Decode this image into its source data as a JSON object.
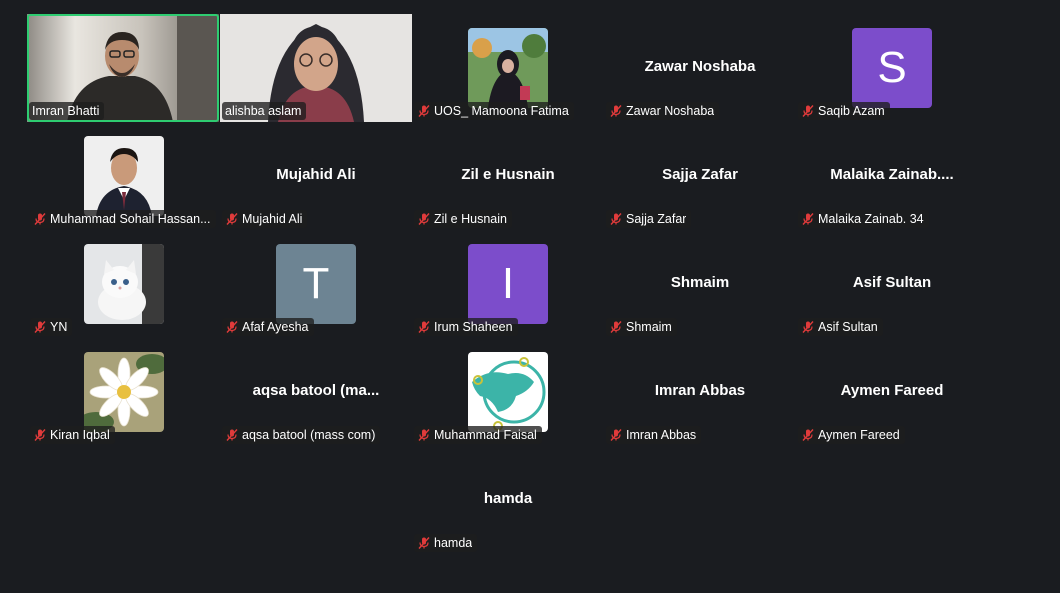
{
  "colors": {
    "background": "#1a1c20",
    "speaking_border": "#2ecc71",
    "avatar_purple": "#7c4dcb",
    "avatar_slate": "#6d8493",
    "muted_mic": "#e03b3b"
  },
  "participants": {
    "imran_bhatti": {
      "label": "Imran Bhatti"
    },
    "alishba_aslam": {
      "label": "alishba aslam"
    },
    "mamoona_fatima": {
      "label": "UOS_ Mamoona Fatima"
    },
    "zawar_noshaba": {
      "display": "Zawar Noshaba",
      "label": "Zawar Noshaba"
    },
    "saqib_azam": {
      "avatar_letter": "S",
      "label": "Saqib Azam"
    },
    "sohail_hassan": {
      "label": "Muhammad Sohail Hassan..."
    },
    "mujahid_ali": {
      "display": "Mujahid Ali",
      "label": "Mujahid Ali"
    },
    "zil_e_husnain": {
      "display": "Zil e Husnain",
      "label": "Zil e Husnain"
    },
    "sajja_zafar": {
      "display": "Sajja Zafar",
      "label": "Sajja Zafar"
    },
    "malaika_zainab": {
      "display": "Malaika  Zainab....",
      "label": "Malaika Zainab. 34"
    },
    "yn": {
      "label": "YN"
    },
    "afaf_ayesha": {
      "avatar_letter": "T",
      "label": "Afaf Ayesha"
    },
    "irum_shaheen": {
      "avatar_letter": "I",
      "label": "Irum Shaheen"
    },
    "shmaim": {
      "display": "Shmaim",
      "label": "Shmaim"
    },
    "asif_sultan": {
      "display": "Asif Sultan",
      "label": "Asif Sultan"
    },
    "kiran_iqbal": {
      "label": "Kiran Iqbal"
    },
    "aqsa_batool": {
      "display": "aqsa  batool  (ma...",
      "label": "aqsa batool (mass com)"
    },
    "muhammad_faisal": {
      "label": "Muhammad Faisal"
    },
    "imran_abbas": {
      "display": "Imran Abbas",
      "label": "Imran Abbas"
    },
    "aymen_fareed": {
      "display": "Aymen Fareed",
      "label": "Aymen Fareed"
    },
    "hamda": {
      "display": "hamda",
      "label": "hamda"
    }
  }
}
